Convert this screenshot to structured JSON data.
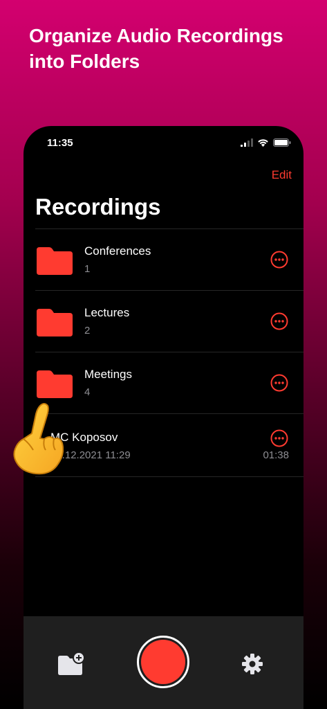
{
  "headline": "Organize Audio Recordings into Folders",
  "status_bar": {
    "time": "11:35"
  },
  "nav": {
    "edit_label": "Edit",
    "title": "Recordings"
  },
  "folders": [
    {
      "name": "Conferences",
      "count": "1"
    },
    {
      "name": "Lectures",
      "count": "2"
    },
    {
      "name": "Meetings",
      "count": "4"
    }
  ],
  "recording": {
    "title": "MC Koposov",
    "date": "12.12.2021 11:29",
    "duration": "01:38"
  },
  "colors": {
    "accent": "#ff3b30",
    "folder": "#ff3b30",
    "tab_bar": "#1f1f1f"
  },
  "icons": [
    "folder-icon",
    "more-icon",
    "new-folder-icon",
    "record-icon",
    "gear-icon",
    "pointing-hand-icon",
    "signal-icon",
    "wifi-icon",
    "battery-icon"
  ]
}
